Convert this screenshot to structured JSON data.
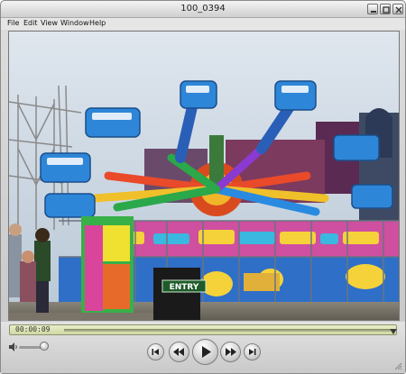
{
  "window": {
    "title": "100_0394"
  },
  "menu": [
    {
      "label": "File"
    },
    {
      "label": "Edit"
    },
    {
      "label": "View"
    },
    {
      "label": "Window"
    },
    {
      "label": "Help"
    }
  ],
  "video": {
    "sign_text": "ENTRY",
    "icon": "video-frame"
  },
  "timeline": {
    "current_time": "00:00:09",
    "progress": 0.85
  },
  "volume": {
    "level": 0.8
  },
  "transport": {
    "buttons": [
      "previous-icon",
      "rewind-icon",
      "play-icon",
      "fast-forward-icon",
      "next-icon"
    ]
  },
  "colors": {
    "timebar": "#d8e0b0",
    "window_chrome": "#d0d0d0"
  }
}
